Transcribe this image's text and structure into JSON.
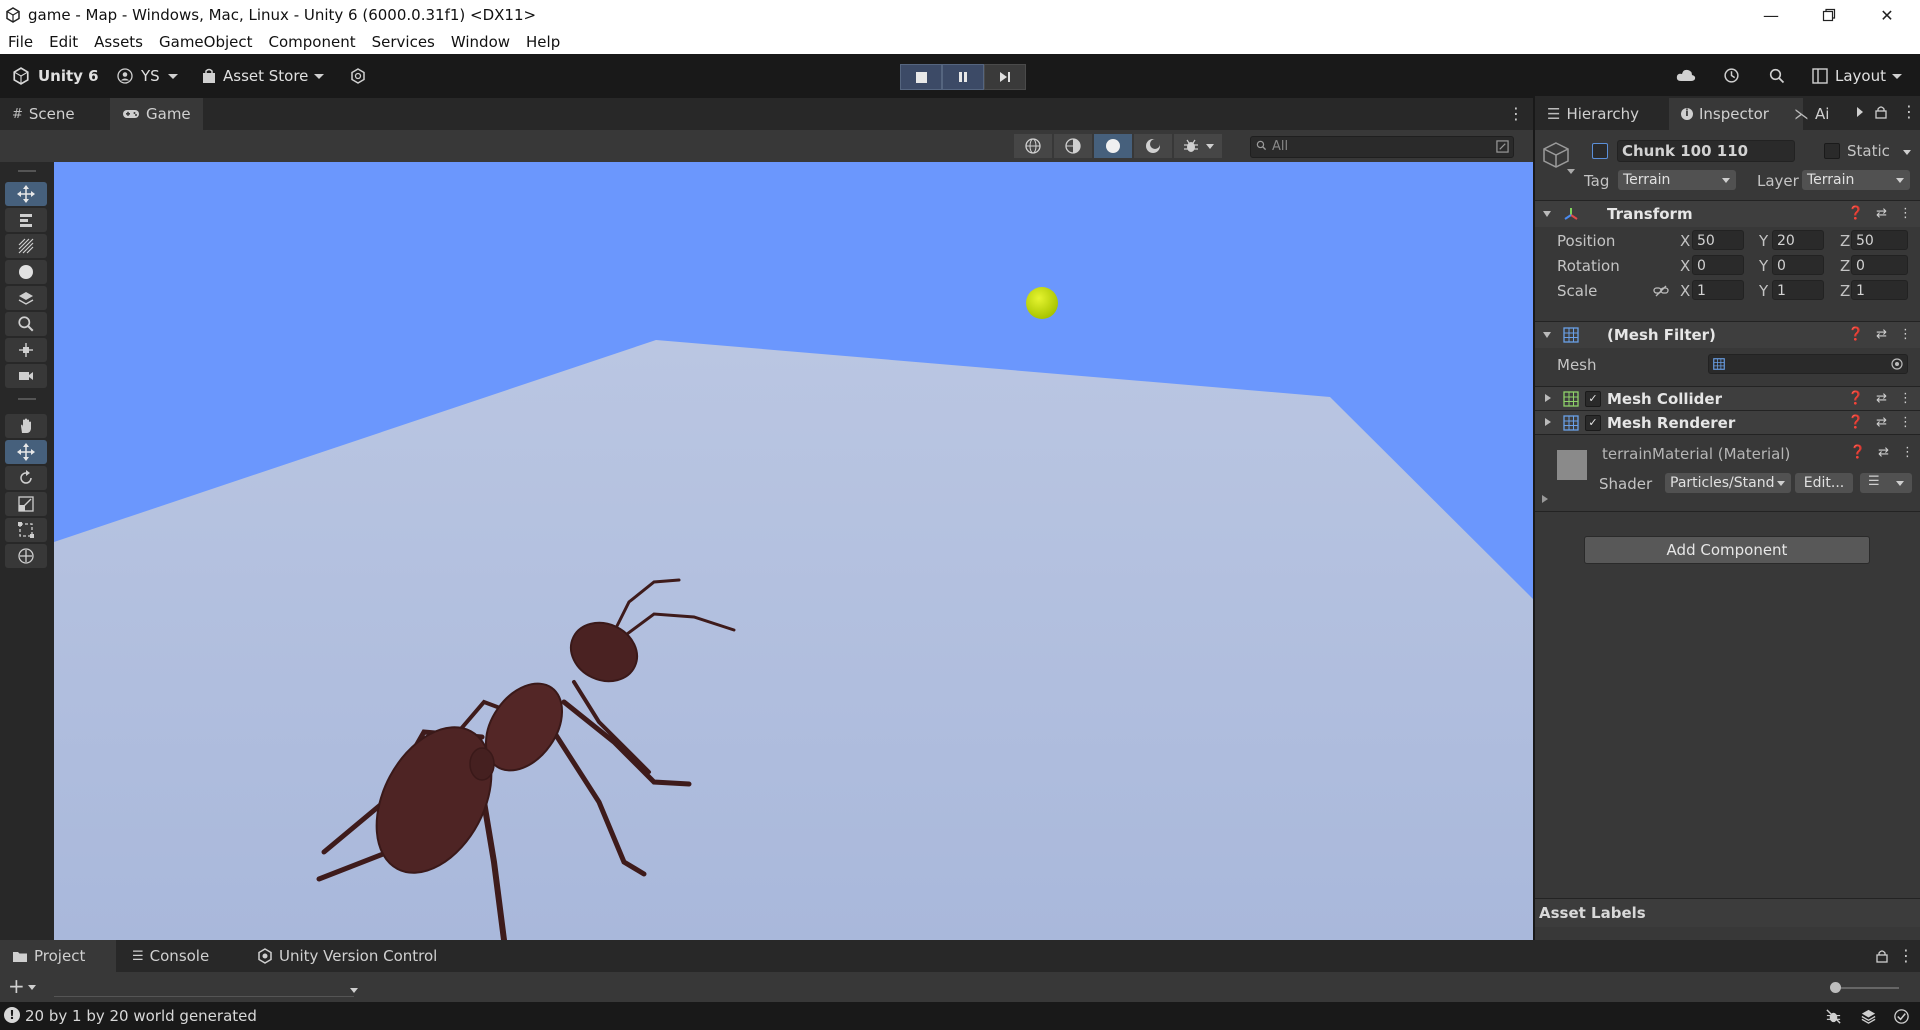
{
  "window": {
    "title": "game - Map - Windows, Mac, Linux - Unity 6 (6000.0.31f1) <DX11>"
  },
  "menu": [
    "File",
    "Edit",
    "Assets",
    "GameObject",
    "Component",
    "Services",
    "Window",
    "Help"
  ],
  "toolbar": {
    "unity_label": "Unity 6",
    "account_label": "YS",
    "asset_store_label": "Asset Store",
    "layout_label": "Layout"
  },
  "view_tabs": {
    "scene": "Scene",
    "game": "Game"
  },
  "scene_search": {
    "placeholder": "All"
  },
  "right_tabs": {
    "hierarchy": "Hierarchy",
    "inspector": "Inspector",
    "third": "Ai"
  },
  "inspector": {
    "object_name": "Chunk 100 110",
    "static_label": "Static",
    "tag_label": "Tag",
    "tag_value": "Terrain",
    "layer_label": "Layer",
    "layer_value": "Terrain",
    "transform": {
      "title": "Transform",
      "position_label": "Position",
      "rotation_label": "Rotation",
      "scale_label": "Scale",
      "position": {
        "x": "50",
        "y": "20",
        "z": "50"
      },
      "rotation": {
        "x": "0",
        "y": "0",
        "z": "0"
      },
      "scale": {
        "x": "1",
        "y": "1",
        "z": "1"
      },
      "axis_x": "X",
      "axis_y": "Y",
      "axis_z": "Z"
    },
    "mesh_filter": {
      "title": "(Mesh Filter)",
      "mesh_label": "Mesh"
    },
    "mesh_collider": {
      "title": "Mesh Collider",
      "checked": true
    },
    "mesh_renderer": {
      "title": "Mesh Renderer",
      "checked": true
    },
    "material": {
      "title": "terrainMaterial (Material)",
      "shader_label": "Shader",
      "shader_value": "Particles/Stand",
      "edit_label": "Edit..."
    },
    "add_component": "Add Component",
    "asset_labels": "Asset Labels"
  },
  "bottom_tabs": {
    "project": "Project",
    "console": "Console",
    "version_control": "Unity Version Control"
  },
  "status": {
    "message": "20 by 1 by 20 world generated"
  },
  "colors": {
    "sky": "#6b97fd",
    "ground": "#b4c1e0",
    "ball": "#c8e000",
    "ant": "#4a2222",
    "accent": "#3c4a66"
  }
}
